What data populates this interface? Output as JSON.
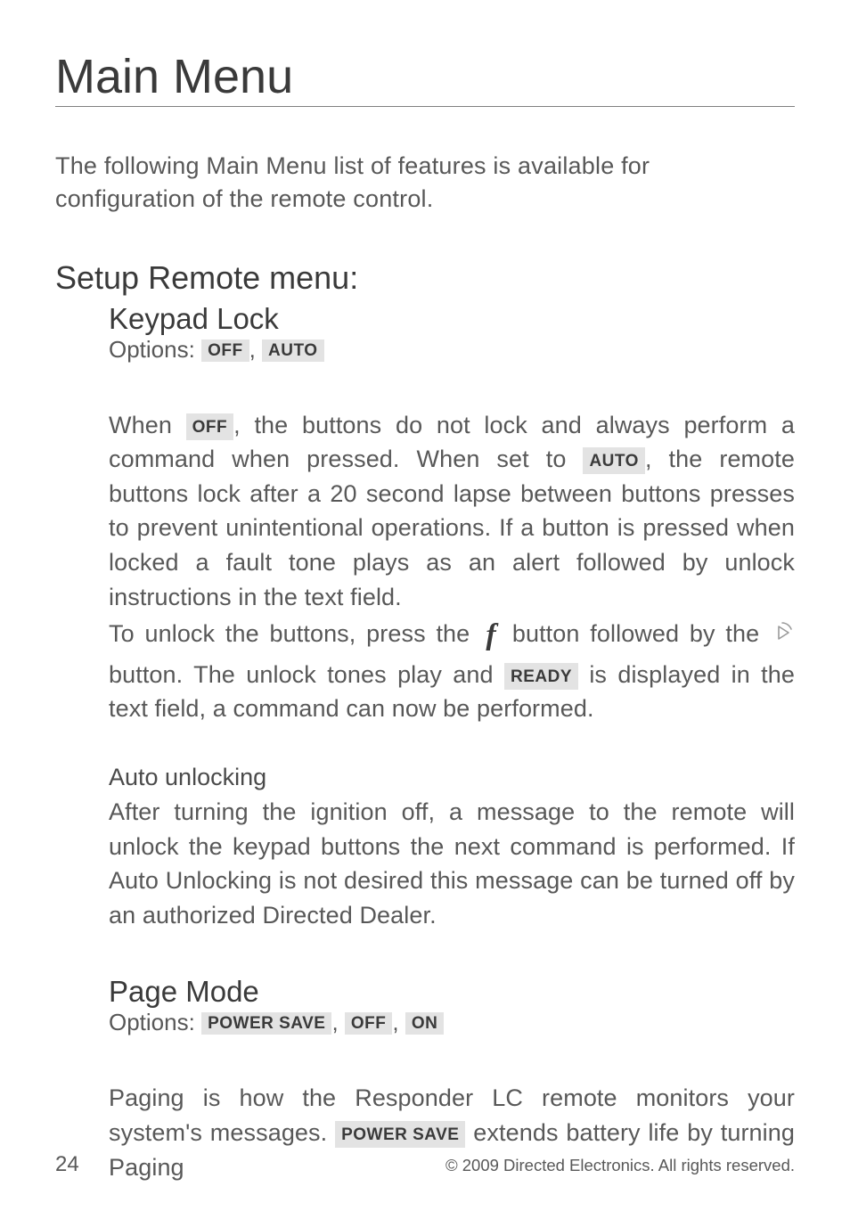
{
  "title": "Main Menu",
  "intro": "The following Main Menu list of features is available for configuration of the remote control.",
  "setup_heading": "Setup Remote menu:",
  "keypad": {
    "heading": "Keypad Lock",
    "options_label": "Options: ",
    "opt_off": "OFF",
    "opt_auto": "AUTO",
    "p1a": "When ",
    "p1b": ", the buttons do not lock and always perform a command when pressed. When set to ",
    "p1c": ", the remote buttons lock after a 20 second lapse between buttons presses to prevent unintentional operations. If a button is pressed when locked a fault tone plays as an alert followed by unlock instructions in the text field.",
    "p2a": "To unlock the buttons, press the ",
    "p2b": " button followed by the ",
    "p2c": " button. The unlock tones play and ",
    "ready": "READY",
    "p2d": " is displayed in the text field, a command can now be performed.",
    "auto_unlock_h": "Auto unlocking",
    "auto_unlock_body": "After turning the ignition off, a message to the remote will unlock the keypad buttons the next command is performed. If Auto Unlocking is not desired this message can be turned off by an authorized Directed Dealer."
  },
  "pagemode": {
    "heading": "Page Mode",
    "options_label": "Options:  ",
    "opt_ps": "POWER SAVE",
    "opt_off": "OFF",
    "opt_on": "ON",
    "p1a": "Paging is how the Responder LC remote monitors your system's messages. ",
    "p1b": " extends battery life by turning Paging"
  },
  "footer": {
    "page": "24",
    "copyright": "© 2009 Directed Electronics. All rights reserved."
  },
  "sep": ", "
}
